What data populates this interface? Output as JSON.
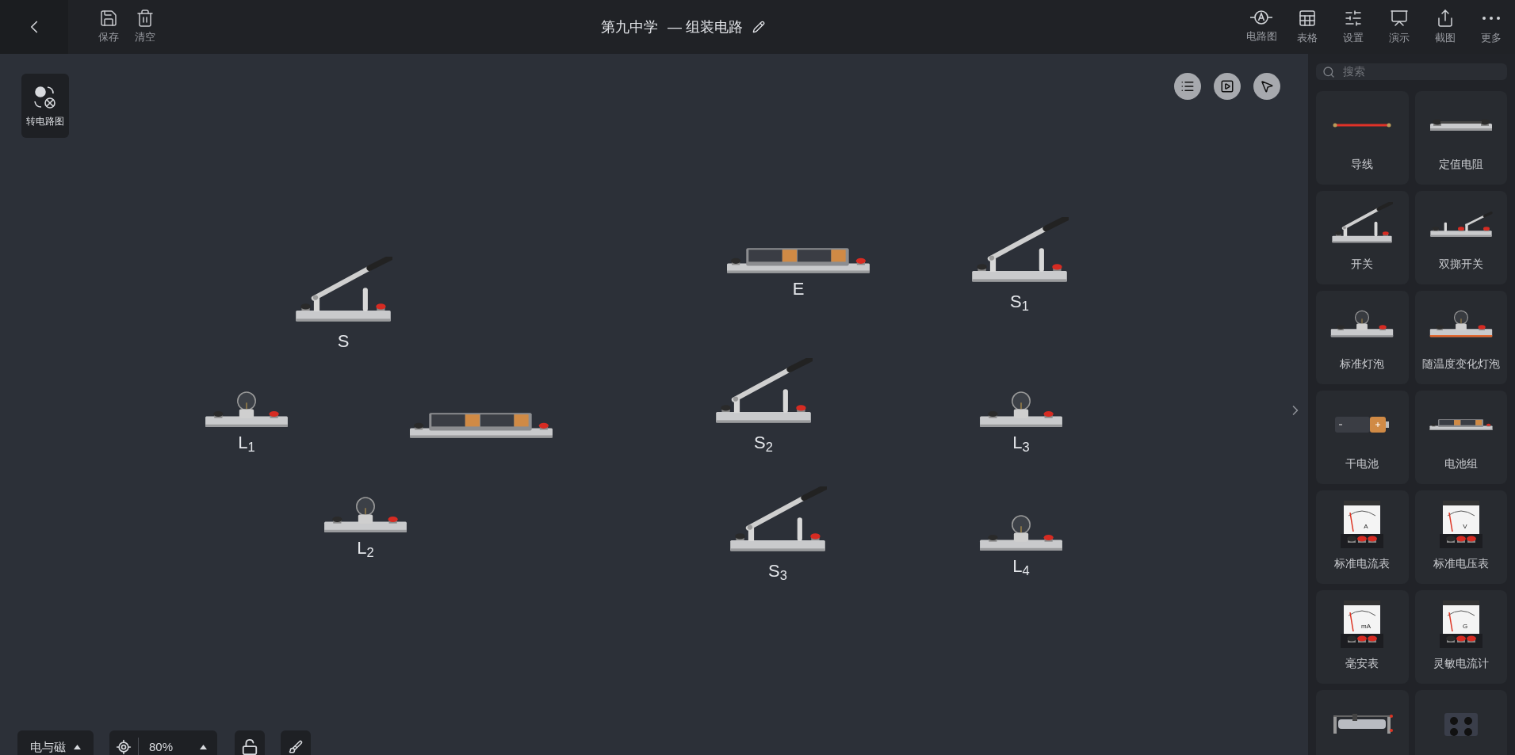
{
  "topbar": {
    "actions": [
      {
        "kind": "save",
        "label": "保存"
      },
      {
        "kind": "clear",
        "label": "清空"
      }
    ],
    "title": "第九中学",
    "subtitle": "— 组装电路",
    "tools": [
      {
        "kind": "diagram",
        "label": "电路图"
      },
      {
        "kind": "table",
        "label": "表格"
      },
      {
        "kind": "settings",
        "label": "设置"
      },
      {
        "kind": "present",
        "label": "演示"
      },
      {
        "kind": "capture",
        "label": "截图"
      },
      {
        "kind": "more",
        "label": "更多"
      }
    ]
  },
  "canvas": {
    "convert_button": "转电路图",
    "components": [
      {
        "kind": "switch",
        "label": "S"
      },
      {
        "kind": "bulb",
        "label": "L$_{1}$"
      },
      {
        "kind": "battery_pack"
      },
      {
        "kind": "bulb",
        "label": "L$_{2}$"
      },
      {
        "kind": "battery_pack",
        "label": "E"
      },
      {
        "kind": "switch",
        "label": "S$_{1}$"
      },
      {
        "kind": "switch",
        "label": "S$_{2}$"
      },
      {
        "kind": "bulb",
        "label": "L$_{3}$"
      },
      {
        "kind": "switch",
        "label": "S$_{3}$"
      },
      {
        "kind": "bulb",
        "label": "L$_{4}$"
      }
    ]
  },
  "palette": {
    "search_placeholder": "搜索",
    "items": [
      {
        "kind": "wire",
        "label": "导线"
      },
      {
        "kind": "resistor",
        "label": "定值电阻"
      },
      {
        "kind": "switch",
        "label": "开关"
      },
      {
        "kind": "double_switch",
        "label": "双掷开关"
      },
      {
        "kind": "bulb",
        "label": "标准灯泡"
      },
      {
        "kind": "thermal_bulb",
        "label": "随温度变化灯泡"
      },
      {
        "kind": "cell",
        "label": "干电池"
      },
      {
        "kind": "battery_pack",
        "label": "电池组"
      },
      {
        "kind": "meter",
        "label": "标准电流表",
        "dial": "A"
      },
      {
        "kind": "meter",
        "label": "标准电压表",
        "dial": "V"
      },
      {
        "kind": "meter",
        "label": "毫安表",
        "dial": "mA"
      },
      {
        "kind": "meter",
        "label": "灵敏电流计",
        "dial": "G"
      },
      {
        "kind": "rheostat"
      },
      {
        "kind": "resistance_box"
      }
    ]
  },
  "bottom_bar": {
    "domain": "电与磁",
    "zoom": "80%"
  }
}
